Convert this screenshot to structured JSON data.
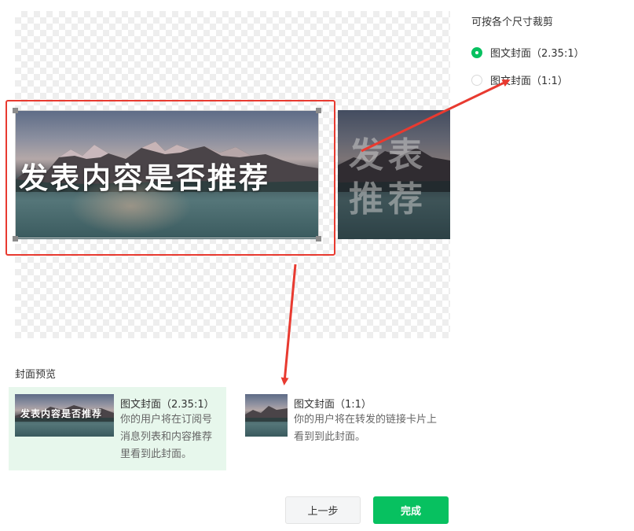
{
  "crop_panel": {
    "title": "可按各个尺寸裁剪",
    "options": [
      {
        "label": "图文封面（2.35:1）",
        "selected": true
      },
      {
        "label": "图文封面（1:1）",
        "selected": false
      }
    ]
  },
  "image": {
    "caption": "发表内容是否推荐",
    "caption_short": "发表推荐"
  },
  "preview": {
    "section_label": "封面预览",
    "wide": {
      "title": "图文封面（2.35:1）",
      "desc_lines": [
        "你的用户将在订阅号",
        "消息列表和内容推荐",
        "里看到此封面。"
      ]
    },
    "square": {
      "title": "图文封面（1:1）",
      "desc_lines": [
        "你的用户将在转发的链接卡片上",
        "看到到此封面。"
      ]
    }
  },
  "buttons": {
    "prev": "上一步",
    "done": "完成"
  },
  "colors": {
    "accent": "#07c160",
    "annotation_red": "#e83a30"
  }
}
